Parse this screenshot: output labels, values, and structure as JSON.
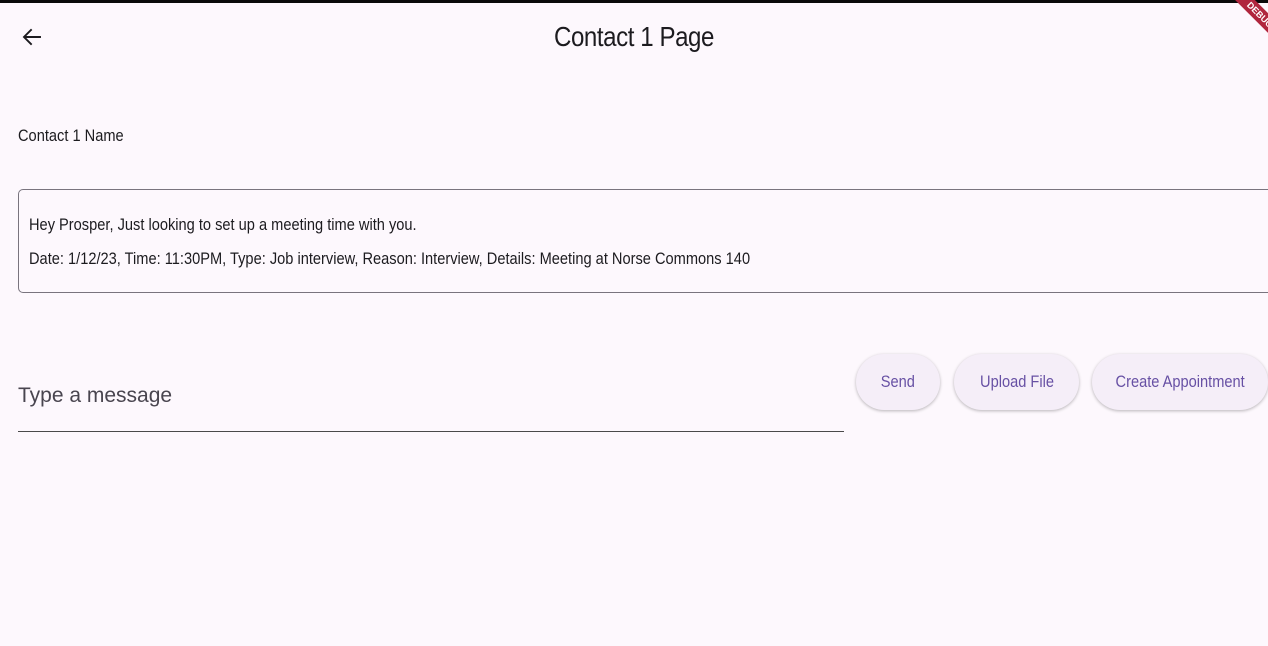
{
  "app_bar": {
    "title": "Contact 1 Page",
    "back_icon": "arrow-left-icon",
    "debug_banner": "DEBUG"
  },
  "contact": {
    "name_label": "Contact 1 Name"
  },
  "message": {
    "line1": "Hey Prosper, Just looking to set up a meeting time with you.",
    "line2": "Date: 1/12/23, Time: 11:30PM, Type: Job interview, Reason: Interview, Details: Meeting at Norse Commons 140"
  },
  "compose": {
    "placeholder": "Type a message",
    "value": ""
  },
  "actions": {
    "send_label": "Send",
    "upload_label": "Upload File",
    "appointment_label": "Create Appointment"
  },
  "colors": {
    "background": "#fdf8fd",
    "button_bg": "#f5eef8",
    "button_text": "#6750a4",
    "outline": "#79747e"
  }
}
